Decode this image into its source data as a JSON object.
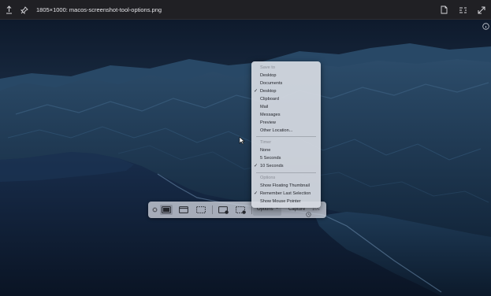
{
  "viewer": {
    "title": "1805×1000: macos-screenshot-tool-options.png",
    "icons": {
      "share": "upload-icon",
      "pin": "pin-icon",
      "document": "document-icon",
      "text_recognition": "text-scan-icon",
      "expand": "expand-icon",
      "info": "info-icon"
    }
  },
  "capture_toolbar": {
    "options_label": "Options",
    "options_chevron": "⌄",
    "capture_label": "Capture",
    "timer_label": "10s",
    "modes": [
      "close",
      "capture-entire-screen",
      "capture-window",
      "capture-selection",
      "record-entire-screen",
      "record-selection"
    ]
  },
  "menu": {
    "save_to": {
      "heading": "Save to",
      "items": [
        {
          "label": "Desktop",
          "checked": false
        },
        {
          "label": "Documents",
          "checked": false
        },
        {
          "label": "Desktop",
          "checked": true
        },
        {
          "label": "Clipboard",
          "checked": false
        },
        {
          "label": "Mail",
          "checked": false
        },
        {
          "label": "Messages",
          "checked": false
        },
        {
          "label": "Preview",
          "checked": false
        },
        {
          "label": "Other Location...",
          "checked": false
        }
      ]
    },
    "timer": {
      "heading": "Timer",
      "items": [
        {
          "label": "None",
          "checked": false
        },
        {
          "label": "5 Seconds",
          "checked": false
        },
        {
          "label": "10 Seconds",
          "checked": true
        }
      ]
    },
    "options": {
      "heading": "Options",
      "items": [
        {
          "label": "Show Floating Thumbnail",
          "checked": false
        },
        {
          "label": "Remember Last Selection",
          "checked": true
        },
        {
          "label": "Show Mouse Pointer",
          "checked": false
        }
      ]
    },
    "checkmark": "✓"
  },
  "colors": {
    "sky_top": "#0f1c2f",
    "sky_bottom": "#3c5a7c",
    "sea": "#10203a",
    "mountains": "#1d3a55"
  }
}
